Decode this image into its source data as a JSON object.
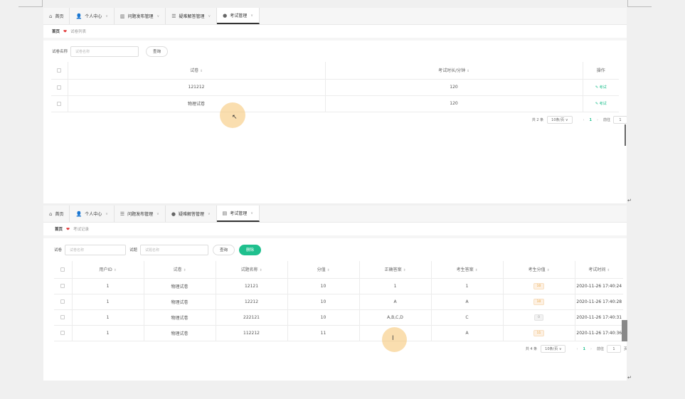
{
  "top": {
    "tabs": [
      {
        "label": "首页"
      },
      {
        "label": "个人中心"
      },
      {
        "label": "问题发布管理"
      },
      {
        "label": "疑难解答管理"
      },
      {
        "label": "考试管理"
      }
    ],
    "breadcrumb": {
      "home": "首页",
      "current": "试卷列表"
    },
    "search_label": "试卷名称",
    "search_placeholder": "试卷名称",
    "query_label": "查询",
    "headers": [
      "试卷",
      "考试时长/分钟",
      "操作"
    ],
    "rows": [
      {
        "name": "121212",
        "duration": "120",
        "action": "考试"
      },
      {
        "name": "物理试卷",
        "duration": "120",
        "action": "考试"
      }
    ],
    "pager": {
      "total": "共 2 条",
      "size": "10条/页",
      "page": "1",
      "goto": "前往",
      "goto_value": "1"
    }
  },
  "bottom": {
    "tabs": [
      {
        "label": "首页"
      },
      {
        "label": "个人中心"
      },
      {
        "label": "问题发布管理"
      },
      {
        "label": "疑难解答管理"
      },
      {
        "label": "考试管理"
      }
    ],
    "breadcrumb": {
      "home": "首页",
      "current": "考试记录"
    },
    "search_label1": "试卷",
    "search_placeholder1": "试卷名称",
    "search_label2": "试题",
    "search_placeholder2": "试题名称",
    "query_label": "查询",
    "delete_label": "删除",
    "headers": [
      "用户ID",
      "试卷",
      "试题名称",
      "分值",
      "正确答案",
      "考生答案",
      "考生分值",
      "考试时间"
    ],
    "rows": [
      {
        "uid": "1",
        "paper": "物理试卷",
        "q": "12121",
        "score": "10",
        "correct": "1",
        "answer": "1",
        "got": "10",
        "got_gray": false,
        "time": "2020-11-26 17:40:24"
      },
      {
        "uid": "1",
        "paper": "物理试卷",
        "q": "12212",
        "score": "10",
        "correct": "A",
        "answer": "A",
        "got": "10",
        "got_gray": false,
        "time": "2020-11-26 17:40:28"
      },
      {
        "uid": "1",
        "paper": "物理试卷",
        "q": "222121",
        "score": "10",
        "correct": "A,B,C,D",
        "answer": "C",
        "got": "0",
        "got_gray": true,
        "time": "2020-11-26 17:40:31"
      },
      {
        "uid": "1",
        "paper": "物理试卷",
        "q": "112212",
        "score": "11",
        "correct": "",
        "answer": "A",
        "got": "11",
        "got_gray": false,
        "time": "2020-11-26 17:40:36"
      }
    ],
    "pager": {
      "total": "共 4 条",
      "size": "10条/页",
      "page": "1",
      "goto": "前往",
      "goto_value": "1",
      "unit": "页"
    }
  },
  "colors": {
    "accent": "#1fc08e",
    "heart": "#e02c2c",
    "tag": "#e6a23c"
  },
  "icons": {
    "home": "home-icon",
    "user": "user-icon",
    "edit": "edit-icon",
    "heart": "heart-icon"
  }
}
